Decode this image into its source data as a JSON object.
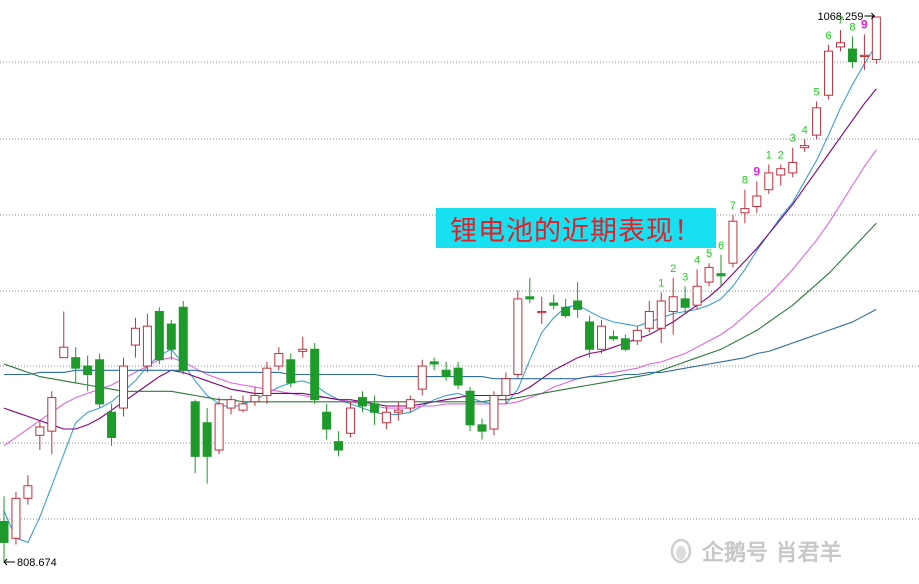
{
  "banner": {
    "text": "锂电池的近期表现！"
  },
  "watermark": {
    "text": "企鹅号 肖君羊",
    "logo_icon": "penguin-icon"
  },
  "colors": {
    "up": "#c0303c",
    "down": "#1e9a2a",
    "td_setup": "#16d316",
    "td_nine": "#e020d8",
    "grid": "#8c8c8c"
  },
  "chart_data": {
    "type": "candlestick",
    "ylim": [
      808.674,
      1068.259
    ],
    "max_label": "1068.259",
    "min_label": "808.674",
    "candles": [
      [
        828,
        818,
        840,
        808.674
      ],
      [
        820,
        839,
        842,
        817
      ],
      [
        839,
        845,
        850,
        836
      ],
      [
        869,
        873,
        876,
        862
      ],
      [
        871,
        887,
        890,
        860
      ],
      [
        906,
        911,
        928,
        906
      ],
      [
        906,
        901,
        911,
        894
      ],
      [
        902,
        898,
        907,
        890
      ],
      [
        905,
        884,
        908,
        882
      ],
      [
        880,
        868,
        884,
        864
      ],
      [
        882,
        902,
        906,
        878
      ],
      [
        912,
        920,
        925,
        906
      ],
      [
        902,
        921,
        927,
        899
      ],
      [
        928,
        905,
        930,
        903
      ],
      [
        922,
        910,
        924,
        905
      ],
      [
        930,
        900,
        933,
        898
      ],
      [
        885,
        859,
        886,
        851
      ],
      [
        875,
        859,
        882,
        846
      ],
      [
        862,
        884,
        887,
        860
      ],
      [
        882,
        886,
        888,
        879
      ],
      [
        881,
        884,
        888,
        880
      ],
      [
        885,
        888,
        892,
        883
      ],
      [
        888,
        901,
        904,
        884
      ],
      [
        902,
        908,
        911,
        900
      ],
      [
        905,
        894,
        908,
        892
      ],
      [
        909,
        910,
        916,
        906
      ],
      [
        910,
        886,
        913,
        884
      ],
      [
        880,
        872,
        884,
        867
      ],
      [
        866,
        862,
        871,
        859
      ],
      [
        870,
        882,
        885,
        868
      ],
      [
        887,
        883,
        890,
        880
      ],
      [
        884,
        880,
        888,
        874
      ],
      [
        875,
        880,
        883,
        872
      ],
      [
        880,
        881,
        885,
        876
      ],
      [
        882,
        886,
        888,
        880
      ],
      [
        891,
        902,
        905,
        888
      ],
      [
        904,
        903,
        906,
        900
      ],
      [
        900,
        897,
        904,
        895
      ],
      [
        901,
        893,
        904,
        891
      ],
      [
        890,
        874,
        892,
        871
      ],
      [
        874,
        871,
        877,
        867
      ],
      [
        872,
        888,
        890,
        869
      ],
      [
        888,
        896,
        899,
        884
      ],
      [
        898,
        934,
        938,
        896
      ],
      [
        935,
        934,
        944,
        932
      ],
      [
        928,
        928,
        935,
        922
      ],
      [
        932,
        931,
        936,
        929
      ],
      [
        930,
        926,
        934,
        925
      ],
      [
        933,
        929,
        942,
        925
      ],
      [
        923,
        910,
        926,
        906
      ],
      [
        910,
        921,
        924,
        908
      ],
      [
        916,
        915,
        919,
        914
      ],
      [
        915,
        910,
        917,
        909
      ],
      [
        914,
        919,
        921,
        912
      ],
      [
        920,
        928,
        933,
        918
      ],
      [
        920,
        933,
        937,
        913
      ],
      [
        928,
        935,
        944,
        917
      ],
      [
        934,
        930,
        940,
        927
      ],
      [
        931,
        940,
        948,
        929
      ],
      [
        942,
        949,
        951,
        940
      ],
      [
        946,
        945,
        955,
        940
      ],
      [
        951,
        971,
        974,
        949
      ],
      [
        975,
        977,
        986,
        970
      ],
      [
        978,
        983,
        990,
        975
      ],
      [
        986,
        994,
        998,
        984
      ],
      [
        993,
        996,
        998,
        988
      ],
      [
        994,
        999,
        1006,
        992
      ],
      [
        1006,
        1007,
        1010,
        1004
      ],
      [
        1012,
        1025,
        1028,
        1010
      ],
      [
        1031,
        1052,
        1055,
        1029
      ],
      [
        1054,
        1056,
        1062,
        1052
      ],
      [
        1053,
        1047,
        1059,
        1044
      ],
      [
        1050,
        1050,
        1060,
        1043
      ],
      [
        1048,
        1068.259,
        1068.259,
        1046
      ]
    ],
    "ma_series": [
      {
        "color": "#3b9fd4",
        "values": [
          833,
          820,
          818,
          830,
          845,
          860,
          875,
          880,
          882,
          885,
          890,
          895,
          902,
          907,
          910,
          903,
          895,
          888,
          884,
          882,
          884,
          886,
          889,
          892,
          894,
          895,
          893,
          889,
          886,
          884,
          882,
          880,
          879,
          879,
          880,
          883,
          886,
          888,
          889,
          887,
          885,
          884,
          884,
          891,
          905,
          918,
          925,
          930,
          931,
          928,
          925,
          923,
          922,
          921,
          923,
          925,
          927,
          928,
          929,
          931,
          934,
          940,
          948,
          957,
          965,
          973,
          980,
          990,
          1000,
          1012,
          1025,
          1036,
          1046,
          1055
        ]
      },
      {
        "color": "#e066e0",
        "values": [
          864,
          868,
          872,
          876,
          880,
          884,
          887,
          889,
          891,
          893,
          896,
          899,
          902,
          905,
          906,
          904,
          901,
          898,
          896,
          894,
          893,
          892,
          891,
          890,
          889,
          888,
          887,
          887,
          886,
          885,
          884,
          883,
          882,
          882,
          882,
          883,
          883,
          884,
          884,
          884,
          884,
          884,
          884,
          885,
          887,
          889,
          892,
          894,
          896,
          897,
          898,
          899,
          900,
          901,
          903,
          904,
          906,
          908,
          911,
          914,
          917,
          921,
          926,
          931,
          936,
          942,
          948,
          955,
          962,
          970,
          979,
          988,
          997,
          1005
        ]
      },
      {
        "color": "#800080",
        "values": [
          882,
          880,
          878,
          876,
          874,
          872,
          872,
          874,
          877,
          881,
          885,
          889,
          893,
          897,
          900,
          899,
          897,
          895,
          893,
          891,
          890,
          889,
          889,
          889,
          889,
          889,
          888,
          887,
          886,
          886,
          885,
          884,
          883,
          883,
          883,
          884,
          885,
          886,
          887,
          888,
          888,
          888,
          888,
          889,
          892,
          896,
          900,
          903,
          906,
          908,
          909,
          911,
          913,
          915,
          917,
          920,
          923,
          927,
          931,
          935,
          940,
          946,
          952,
          958,
          965,
          972,
          979,
          987,
          995,
          1003,
          1011,
          1019,
          1027,
          1034
        ]
      },
      {
        "color": "#2b7a3a",
        "values": [
          903,
          901,
          899,
          897,
          896,
          895,
          894,
          893,
          892,
          891,
          890,
          890,
          890,
          890,
          890,
          889,
          888,
          887,
          886,
          886,
          885,
          885,
          885,
          885,
          885,
          885,
          885,
          885,
          885,
          885,
          885,
          885,
          885,
          885,
          885,
          885,
          885,
          885,
          885,
          885,
          885,
          886,
          886,
          887,
          888,
          889,
          890,
          891,
          892,
          893,
          894,
          895,
          896,
          897,
          898,
          900,
          902,
          904,
          906,
          908,
          910,
          913,
          916,
          919,
          923,
          927,
          931,
          936,
          941,
          946,
          952,
          958,
          964,
          970
        ]
      },
      {
        "color": "#2f6f9f",
        "values": [
          898,
          898,
          898,
          899,
          899,
          899,
          900,
          900,
          900,
          900,
          900,
          900,
          900,
          900,
          900,
          900,
          900,
          899,
          899,
          899,
          899,
          899,
          899,
          899,
          898,
          898,
          898,
          898,
          898,
          898,
          898,
          898,
          897,
          897,
          897,
          897,
          897,
          897,
          897,
          897,
          897,
          896,
          896,
          896,
          896,
          896,
          896,
          896,
          896,
          897,
          897,
          897,
          898,
          898,
          899,
          899,
          900,
          901,
          902,
          903,
          904,
          905,
          906,
          908,
          909,
          911,
          913,
          915,
          917,
          919,
          921,
          923,
          926,
          929
        ]
      }
    ],
    "td_labels": [
      {
        "i": 55,
        "text": "1",
        "kind": "setup"
      },
      {
        "i": 56,
        "text": "2",
        "kind": "setup"
      },
      {
        "i": 57,
        "text": "3",
        "kind": "setup"
      },
      {
        "i": 58,
        "text": "4",
        "kind": "setup"
      },
      {
        "i": 59,
        "text": "5",
        "kind": "setup"
      },
      {
        "i": 60,
        "text": "6",
        "kind": "setup"
      },
      {
        "i": 61,
        "text": "7",
        "kind": "setup"
      },
      {
        "i": 62,
        "text": "8",
        "kind": "setup"
      },
      {
        "i": 63,
        "text": "9",
        "kind": "nine"
      },
      {
        "i": 64,
        "text": "1",
        "kind": "setup"
      },
      {
        "i": 65,
        "text": "2",
        "kind": "setup"
      },
      {
        "i": 66,
        "text": "3",
        "kind": "setup"
      },
      {
        "i": 67,
        "text": "4",
        "kind": "setup"
      },
      {
        "i": 68,
        "text": "5",
        "kind": "setup"
      },
      {
        "i": 69,
        "text": "6",
        "kind": "setup"
      },
      {
        "i": 70,
        "text": "7",
        "kind": "setup"
      },
      {
        "i": 71,
        "text": "8",
        "kind": "setup"
      },
      {
        "i": 72,
        "text": "9",
        "kind": "nine"
      }
    ],
    "grid": true
  }
}
